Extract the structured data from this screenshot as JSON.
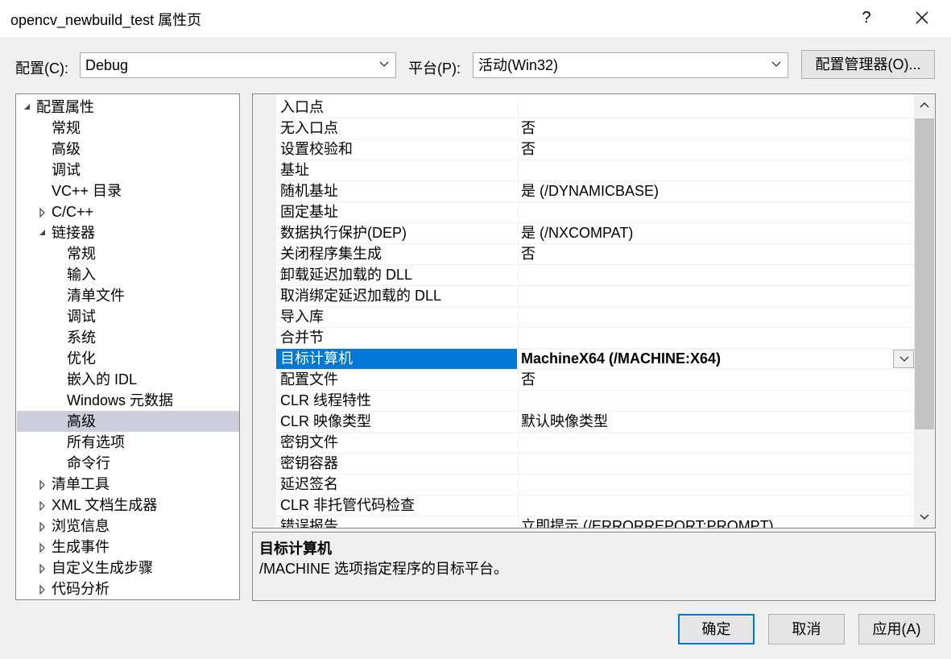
{
  "window": {
    "title": "opencv_newbuild_test 属性页",
    "help_label": "?"
  },
  "toolbar": {
    "config_label": "配置(C):",
    "config_value": "Debug",
    "platform_label": "平台(P):",
    "platform_value": "活动(Win32)",
    "config_manager_label": "配置管理器(O)..."
  },
  "tree": {
    "items": [
      {
        "label": "配置属性",
        "expander": "expanded"
      },
      {
        "label": "常规",
        "expander": "none"
      },
      {
        "label": "高级",
        "expander": "none"
      },
      {
        "label": "调试",
        "expander": "none"
      },
      {
        "label": "VC++ 目录",
        "expander": "none"
      },
      {
        "label": "C/C++",
        "expander": "collapsed"
      },
      {
        "label": "链接器",
        "expander": "expanded"
      },
      {
        "label": "常规",
        "expander": "none"
      },
      {
        "label": "输入",
        "expander": "none"
      },
      {
        "label": "清单文件",
        "expander": "none"
      },
      {
        "label": "调试",
        "expander": "none"
      },
      {
        "label": "系统",
        "expander": "none"
      },
      {
        "label": "优化",
        "expander": "none"
      },
      {
        "label": "嵌入的 IDL",
        "expander": "none"
      },
      {
        "label": "Windows 元数据",
        "expander": "none"
      },
      {
        "label": "高级",
        "expander": "none",
        "selected": true
      },
      {
        "label": "所有选项",
        "expander": "none"
      },
      {
        "label": "命令行",
        "expander": "none"
      },
      {
        "label": "清单工具",
        "expander": "collapsed"
      },
      {
        "label": "XML 文档生成器",
        "expander": "collapsed"
      },
      {
        "label": "浏览信息",
        "expander": "collapsed"
      },
      {
        "label": "生成事件",
        "expander": "collapsed"
      },
      {
        "label": "自定义生成步骤",
        "expander": "collapsed"
      },
      {
        "label": "代码分析",
        "expander": "collapsed"
      }
    ]
  },
  "grid": {
    "rows": [
      {
        "name": "入口点",
        "value": ""
      },
      {
        "name": "无入口点",
        "value": "否"
      },
      {
        "name": "设置校验和",
        "value": "否"
      },
      {
        "name": "基址",
        "value": ""
      },
      {
        "name": "随机基址",
        "value": "是 (/DYNAMICBASE)"
      },
      {
        "name": "固定基址",
        "value": ""
      },
      {
        "name": "数据执行保护(DEP)",
        "value": "是 (/NXCOMPAT)"
      },
      {
        "name": "关闭程序集生成",
        "value": "否"
      },
      {
        "name": "卸载延迟加载的 DLL",
        "value": ""
      },
      {
        "name": "取消绑定延迟加载的 DLL",
        "value": ""
      },
      {
        "name": "导入库",
        "value": ""
      },
      {
        "name": "合并节",
        "value": ""
      },
      {
        "name": "目标计算机",
        "value": "MachineX64 (/MACHINE:X64)",
        "selected": true
      },
      {
        "name": "配置文件",
        "value": "否"
      },
      {
        "name": "CLR 线程特性",
        "value": ""
      },
      {
        "name": "CLR 映像类型",
        "value": "默认映像类型"
      },
      {
        "name": "密钥文件",
        "value": ""
      },
      {
        "name": "密钥容器",
        "value": ""
      },
      {
        "name": "延迟签名",
        "value": ""
      },
      {
        "name": "CLR 非托管代码检查",
        "value": ""
      },
      {
        "name": "错误报告",
        "value": "立即提示 (/ERRORREPORT:PROMPT)"
      }
    ]
  },
  "description": {
    "title": "目标计算机",
    "text": "/MACHINE 选项指定程序的目标平台。"
  },
  "buttons": {
    "ok": "确定",
    "cancel": "取消",
    "apply": "应用(A)"
  },
  "colors": {
    "accent": "#0078d7",
    "tree_selection": "#cccedb"
  }
}
